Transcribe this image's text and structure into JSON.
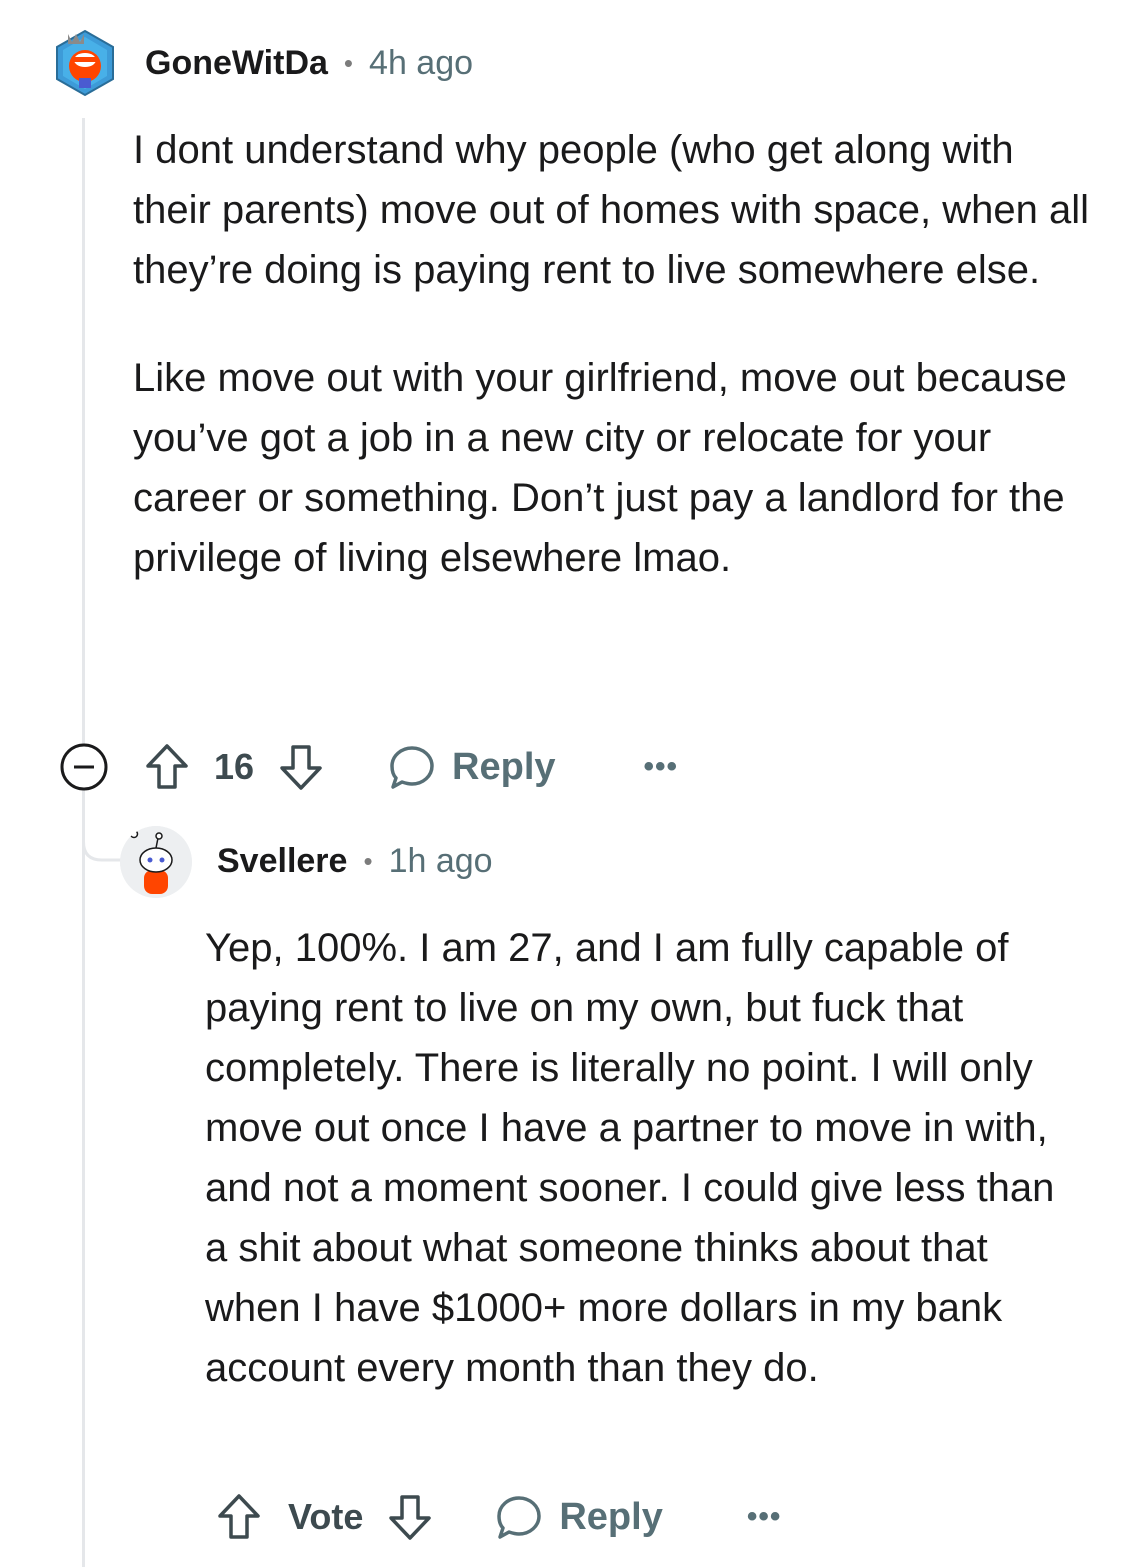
{
  "comments": [
    {
      "username": "GoneWitDa",
      "separator": "•",
      "time": "4h ago",
      "paragraphs": [
        "I dont understand why people (who get along with their parents) move out of homes with space, when all they’re doing is paying rent to live somewhere else.",
        "Like move out with your girlfriend, move out because you’ve got a job in a new city or relocate for your career or something. Don’t just pay a landlord for the privilege of living elsewhere lmao."
      ],
      "score": "16",
      "reply_label": "Reply",
      "more_label": "•••",
      "icons": [
        "collapse-icon",
        "upvote-icon",
        "downvote-icon",
        "reply-bubble-icon",
        "more-icon"
      ]
    },
    {
      "username": "Svellere",
      "separator": "•",
      "time": "1h ago",
      "paragraphs": [
        "Yep, 100%. I am 27, and I am fully capable of paying rent to live on my own, but fuck that completely. There is literally no point. I will only move out once I have a partner to move in with, and not a moment sooner. I could give less than a shit about what someone thinks about that when I have $1000+ more dollars in my bank account every month than they do."
      ],
      "vote_label": "Vote",
      "reply_label": "Reply",
      "more_label": "•••",
      "icons": [
        "upvote-icon",
        "downvote-icon",
        "reply-bubble-icon",
        "more-icon"
      ]
    }
  ],
  "colors": {
    "text": "#1a1a1b",
    "meta": "#576f76",
    "thread_line": "#e5e7ea",
    "avatar1_bg": "#3d9bd8",
    "avatar1_snoo": "#ff4500"
  }
}
